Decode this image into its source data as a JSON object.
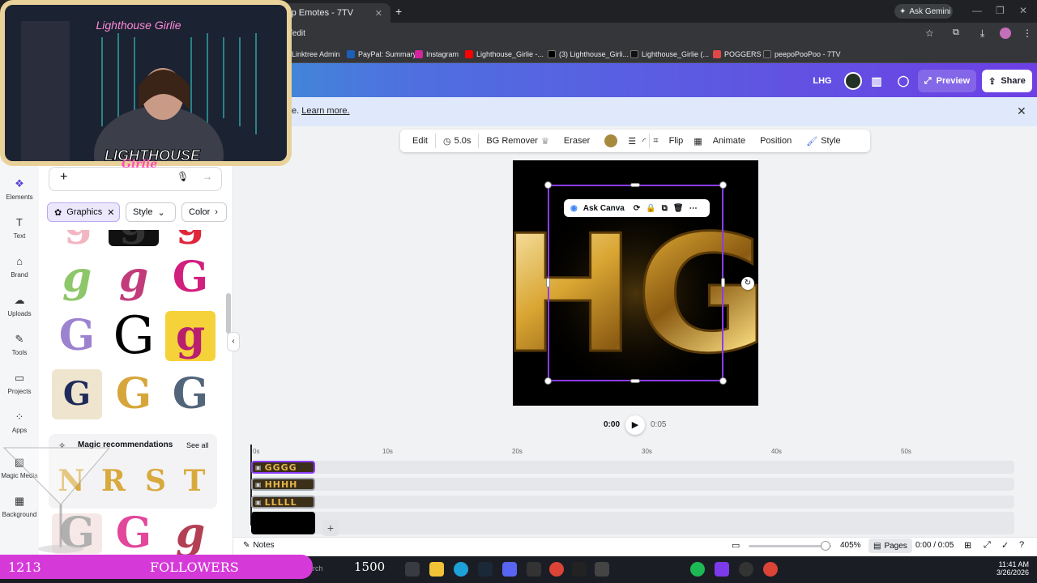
{
  "browser": {
    "tabs": [
      "Top Emotes - 7TV"
    ],
    "ask_gemini": "Ask Gemini",
    "url": "/edit",
    "bookmarks": [
      "Linktree Admin",
      "PayPal: Summary",
      "Instagram",
      "Lighthouse_Girlie -...",
      "(3) Lighthouse_Girli...",
      "Lighthouse_Girlie (...",
      "POGGERS",
      "peepoPooPoo - 7TV"
    ]
  },
  "canva_header": {
    "doc_title": "LHG",
    "preview_label": "Preview",
    "share_label": "Share"
  },
  "infobar": {
    "text_prefix": "e. ",
    "learn_more": "Learn more."
  },
  "sidebar": {
    "rail": [
      {
        "label": "Elements",
        "icon": "elements-icon"
      },
      {
        "label": "Text",
        "icon": "text-icon"
      },
      {
        "label": "Brand",
        "icon": "brand-icon"
      },
      {
        "label": "Uploads",
        "icon": "uploads-icon"
      },
      {
        "label": "Tools",
        "icon": "tools-icon"
      },
      {
        "label": "Projects",
        "icon": "projects-icon"
      },
      {
        "label": "Apps",
        "icon": "apps-icon"
      },
      {
        "label": "Magic Media",
        "icon": "magic-media-icon"
      },
      {
        "label": "Background",
        "icon": "background-icon"
      }
    ],
    "chips": {
      "graphics": "Graphics",
      "style": "Style",
      "color": "Color"
    },
    "magic_title": "Magic recommendations",
    "see_all": "See all",
    "magic_letters": [
      "N",
      "R",
      "S",
      "T"
    ]
  },
  "toolbar": {
    "edit": "Edit",
    "duration": "5.0s",
    "bg_remover": "BG Remover",
    "eraser": "Eraser",
    "flip": "Flip",
    "animate": "Animate",
    "position": "Position",
    "style": "Style",
    "fill_color": "#a88a3e"
  },
  "canvas": {
    "ask_canva": "Ask Canva",
    "design_letters": "HG",
    "current_time": "0:00",
    "total_time": "0:05"
  },
  "timeline": {
    "ticks": [
      "0s",
      "10s",
      "20s",
      "30s",
      "40s",
      "50s"
    ],
    "clips": [
      "GGGG",
      "HHHH",
      "LLLLL"
    ]
  },
  "bottombar": {
    "notes": "Notes",
    "zoom": "405%",
    "pages": "Pages",
    "time": "0:00 / 0:05"
  },
  "taskbar": {
    "search": "Search",
    "time": "11:41 AM",
    "date": "3/26/2026"
  },
  "overlay": {
    "cam_neon": "Lighthouse Girlie",
    "cam_logo_top": "LIGHTHOUSE",
    "cam_logo_bottom": "Girlie",
    "followers_count": "1213",
    "followers_label": "FOLLOWERS",
    "followers_goal": "1500"
  }
}
